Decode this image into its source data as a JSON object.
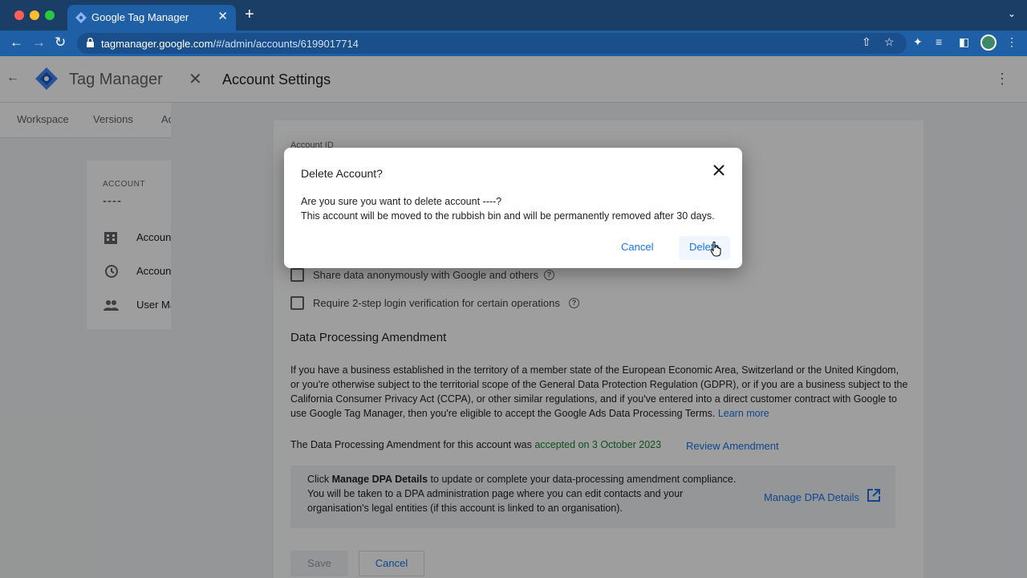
{
  "browser": {
    "tab_title": "Google Tag Manager",
    "tab_close": "✕",
    "new_tab": "+",
    "url_host": "tagmanager.google.com",
    "url_path": "/#/admin/accounts/6199017714"
  },
  "gtm": {
    "app_title": "Tag Manager",
    "tabs": [
      "Workspace",
      "Versions",
      "Ad"
    ],
    "account_caption": "ACCOUNT",
    "account_name": "----",
    "side_items": [
      "Account",
      "Account",
      "User Ma"
    ]
  },
  "settings": {
    "title": "Account Settings",
    "account_id_label": "Account ID",
    "checkbox_share": "Share data anonymously with Google and others",
    "checkbox_2step": "Require 2-step login verification for certain operations",
    "dpa_title": "Data Processing Amendment",
    "dpa_paragraph": "If you have a business established in the territory of a member state of the European Economic Area, Switzerland or the United Kingdom, or you're otherwise subject to the territorial scope of the General Data Protection Regulation (GDPR), or if you are a business subject to the California Consumer Privacy Act (CCPA), or other similar regulations, and if you've entered into a direct customer contract with Google to use Google Tag Manager, then you're eligible to accept the Google Ads Data Processing Terms.",
    "learn_more": "Learn more",
    "dpa_status_prefix": "The Data Processing Amendment for this account was",
    "dpa_status_value": "accepted on 3 October 2023",
    "review_amendment": "Review Amendment",
    "box_click": "Click",
    "box_bold": "Manage DPA Details",
    "box_rest": "to update or complete your data-processing amendment compliance. You will be taken to a DPA administration page where you can edit contacts and your organisation's legal entities (if this account is linked to an organisation).",
    "manage_dpa": "Manage DPA Details",
    "save": "Save",
    "cancel": "Cancel"
  },
  "dialog": {
    "title": "Delete Account?",
    "line1": "Are you sure you want to delete account ----?",
    "line2": "This account will be moved to the rubbish bin and will be permanently removed after 30 days.",
    "cancel": "Cancel",
    "delete": "Delete"
  },
  "colors": {
    "accent": "#1a73e8",
    "accepted_green": "#188038",
    "chrome_blue": "#1f5fa6"
  }
}
